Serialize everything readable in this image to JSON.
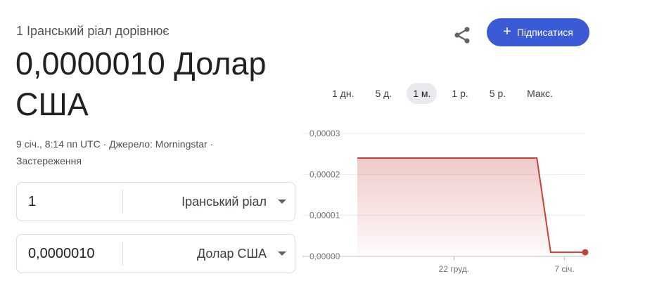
{
  "header": {
    "subtitle": "1 Іранський ріал дорівнює",
    "value": "0,0000010 Долар США",
    "date_time": "9 січ., 8:14 пп UTC",
    "separator": "·",
    "source": "Джерело: Morningstar",
    "disclaimer": "Застереження"
  },
  "converter": {
    "amount_from": "1",
    "currency_from": "Іранський ріал",
    "amount_to": "0,0000010",
    "currency_to": "Долар США"
  },
  "actions": {
    "share_icon": "share-icon",
    "subscribe_label": "Підписатися",
    "subscribe_color": "#3b5bd6"
  },
  "ranges": [
    {
      "label": "1 дн.",
      "active": false
    },
    {
      "label": "5 д.",
      "active": false
    },
    {
      "label": "1 м.",
      "active": true
    },
    {
      "label": "1 р.",
      "active": false
    },
    {
      "label": "5 р.",
      "active": false
    },
    {
      "label": "Макс.",
      "active": false
    }
  ],
  "chart_data": {
    "type": "area",
    "y_tick_labels": [
      "0,00003",
      "0,00002",
      "0,00001",
      "0,00000"
    ],
    "y_ticks": [
      3e-05,
      2e-05,
      1e-05,
      0
    ],
    "ylim": [
      0,
      3e-05
    ],
    "x_tick_labels": [
      "22 груд.",
      "7 січ."
    ],
    "x_ticks": [
      14,
      30
    ],
    "xlim": [
      0,
      33
    ],
    "x": [
      0,
      26,
      28,
      33
    ],
    "y": [
      2.4e-05,
      2.4e-05,
      1e-06,
      1e-06
    ],
    "color": "#c5443a",
    "grid": true
  }
}
